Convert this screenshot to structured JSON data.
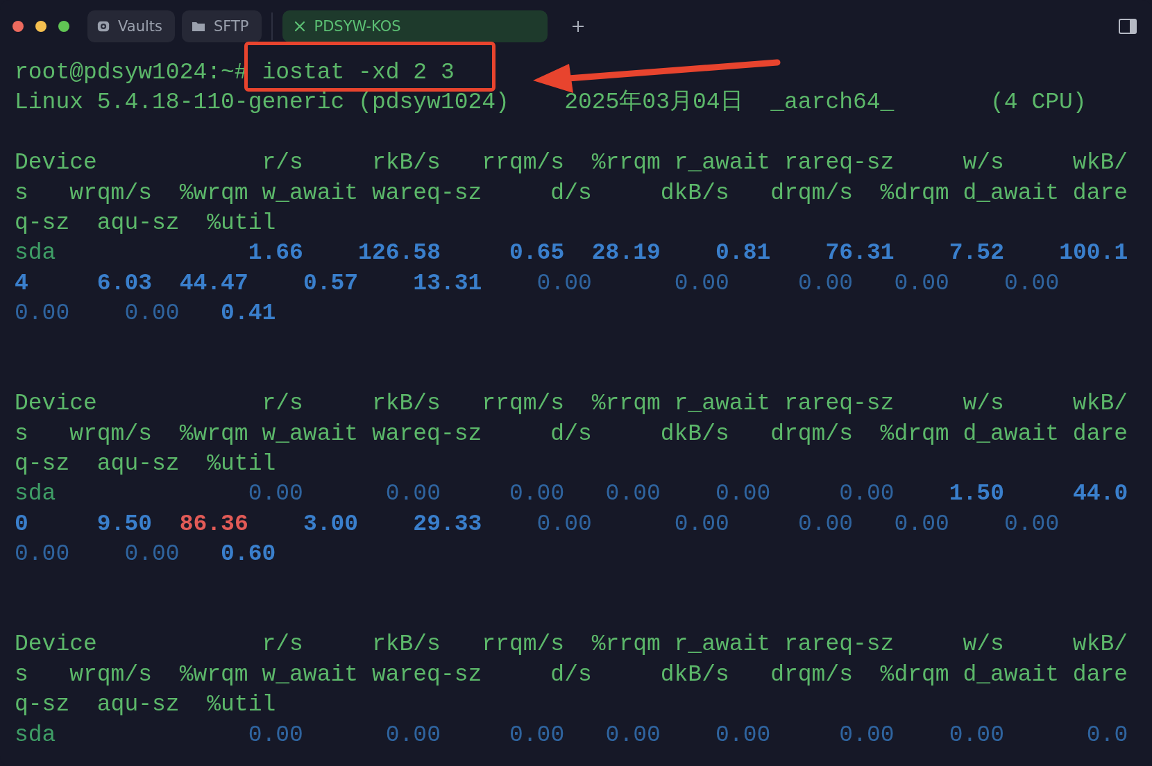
{
  "window": {
    "controls": [
      {
        "kind": "close"
      },
      {
        "kind": "minimize"
      },
      {
        "kind": "zoom"
      }
    ]
  },
  "tabs": [
    {
      "label": "Vaults",
      "kind": "vaults",
      "selected": false
    },
    {
      "label": "SFTP",
      "kind": "folder",
      "selected": false
    },
    {
      "label": "PDSYW-KOS",
      "kind": "terminal",
      "selected": true
    }
  ],
  "terminal": {
    "lines": [
      {
        "kind": "text",
        "segments": [
          {
            "text": "root@pdsyw1024:~#",
            "kind": "prompt"
          },
          {
            "text": " iostat -xd 2 3",
            "kind": "command"
          }
        ]
      },
      {
        "kind": "text",
        "segments": [
          {
            "text": "Linux 5.4.18-110-generic (pdsyw1024)",
            "kind": "text"
          },
          {
            "text": "    2025年03月04日",
            "kind": "text"
          },
          {
            "text": "  _aarch64_",
            "kind": "text"
          },
          {
            "text": "       (4 CPU)",
            "kind": "text"
          }
        ]
      },
      {
        "kind": "blank"
      },
      {
        "kind": "text",
        "segments": [
          {
            "text": "Device            r/s     rkB/s   rrqm/s  %rrqm r_await rareq-sz     w/s     wkB/",
            "kind": "header"
          }
        ]
      },
      {
        "kind": "text",
        "segments": [
          {
            "text": "s   wrqm/s  %wrqm w_await wareq-sz     d/s     dkB/s   drqm/s  %drqm d_await dare",
            "kind": "header"
          }
        ]
      },
      {
        "kind": "text",
        "segments": [
          {
            "text": "q-sz  aqu-sz  %util",
            "kind": "header"
          }
        ]
      },
      {
        "kind": "text",
        "segments": [
          {
            "text": "sda",
            "kind": "device"
          },
          {
            "text": "              1.66",
            "kind": "value"
          },
          {
            "text": "    126.58",
            "kind": "value"
          },
          {
            "text": "     0.65",
            "kind": "value"
          },
          {
            "text": "  28.19",
            "kind": "value"
          },
          {
            "text": "    0.81",
            "kind": "value"
          },
          {
            "text": "    76.31",
            "kind": "value"
          },
          {
            "text": "    7.52",
            "kind": "value"
          },
          {
            "text": "    100.1",
            "kind": "value"
          }
        ]
      },
      {
        "kind": "text",
        "segments": [
          {
            "text": "4",
            "kind": "value"
          },
          {
            "text": "     6.03",
            "kind": "value"
          },
          {
            "text": "  44.47",
            "kind": "value"
          },
          {
            "text": "    0.57",
            "kind": "value"
          },
          {
            "text": "    13.31",
            "kind": "value"
          },
          {
            "text": "    0.00",
            "kind": "zero"
          },
          {
            "text": "      0.00",
            "kind": "zero"
          },
          {
            "text": "     0.00",
            "kind": "zero"
          },
          {
            "text": "   0.00",
            "kind": "zero"
          },
          {
            "text": "    0.00",
            "kind": "zero"
          }
        ]
      },
      {
        "kind": "text",
        "segments": [
          {
            "text": "0.00",
            "kind": "zero"
          },
          {
            "text": "    0.00",
            "kind": "zero"
          },
          {
            "text": "   0.41",
            "kind": "value"
          }
        ]
      },
      {
        "kind": "blank"
      },
      {
        "kind": "blank"
      },
      {
        "kind": "text",
        "segments": [
          {
            "text": "Device            r/s     rkB/s   rrqm/s  %rrqm r_await rareq-sz     w/s     wkB/",
            "kind": "header"
          }
        ]
      },
      {
        "kind": "text",
        "segments": [
          {
            "text": "s   wrqm/s  %wrqm w_await wareq-sz     d/s     dkB/s   drqm/s  %drqm d_await dare",
            "kind": "header"
          }
        ]
      },
      {
        "kind": "text",
        "segments": [
          {
            "text": "q-sz  aqu-sz  %util",
            "kind": "header"
          }
        ]
      },
      {
        "kind": "text",
        "segments": [
          {
            "text": "sda",
            "kind": "device"
          },
          {
            "text": "              0.00",
            "kind": "zero"
          },
          {
            "text": "      0.00",
            "kind": "zero"
          },
          {
            "text": "     0.00",
            "kind": "zero"
          },
          {
            "text": "   0.00",
            "kind": "zero"
          },
          {
            "text": "    0.00",
            "kind": "zero"
          },
          {
            "text": "     0.00",
            "kind": "zero"
          },
          {
            "text": "    1.50",
            "kind": "value"
          },
          {
            "text": "     44.0",
            "kind": "value"
          }
        ]
      },
      {
        "kind": "text",
        "segments": [
          {
            "text": "0",
            "kind": "value"
          },
          {
            "text": "     9.50",
            "kind": "value"
          },
          {
            "text": "  86.36",
            "kind": "alert"
          },
          {
            "text": "    3.00",
            "kind": "value"
          },
          {
            "text": "    29.33",
            "kind": "value"
          },
          {
            "text": "    0.00",
            "kind": "zero"
          },
          {
            "text": "      0.00",
            "kind": "zero"
          },
          {
            "text": "     0.00",
            "kind": "zero"
          },
          {
            "text": "   0.00",
            "kind": "zero"
          },
          {
            "text": "    0.00",
            "kind": "zero"
          }
        ]
      },
      {
        "kind": "text",
        "segments": [
          {
            "text": "0.00",
            "kind": "zero"
          },
          {
            "text": "    0.00",
            "kind": "zero"
          },
          {
            "text": "   0.60",
            "kind": "value"
          }
        ]
      },
      {
        "kind": "blank"
      },
      {
        "kind": "blank"
      },
      {
        "kind": "text",
        "segments": [
          {
            "text": "Device            r/s     rkB/s   rrqm/s  %rrqm r_await rareq-sz     w/s     wkB/",
            "kind": "header"
          }
        ]
      },
      {
        "kind": "text",
        "segments": [
          {
            "text": "s   wrqm/s  %wrqm w_await wareq-sz     d/s     dkB/s   drqm/s  %drqm d_await dare",
            "kind": "header"
          }
        ]
      },
      {
        "kind": "text",
        "segments": [
          {
            "text": "q-sz  aqu-sz  %util",
            "kind": "header"
          }
        ]
      },
      {
        "kind": "text",
        "segments": [
          {
            "text": "sda",
            "kind": "device"
          },
          {
            "text": "              0.00",
            "kind": "zero"
          },
          {
            "text": "      0.00",
            "kind": "zero"
          },
          {
            "text": "     0.00",
            "kind": "zero"
          },
          {
            "text": "   0.00",
            "kind": "zero"
          },
          {
            "text": "    0.00",
            "kind": "zero"
          },
          {
            "text": "     0.00",
            "kind": "zero"
          },
          {
            "text": "    0.00",
            "kind": "zero"
          },
          {
            "text": "      0.0",
            "kind": "zero"
          }
        ]
      }
    ]
  },
  "annotation": {
    "box": true,
    "arrow": true
  }
}
